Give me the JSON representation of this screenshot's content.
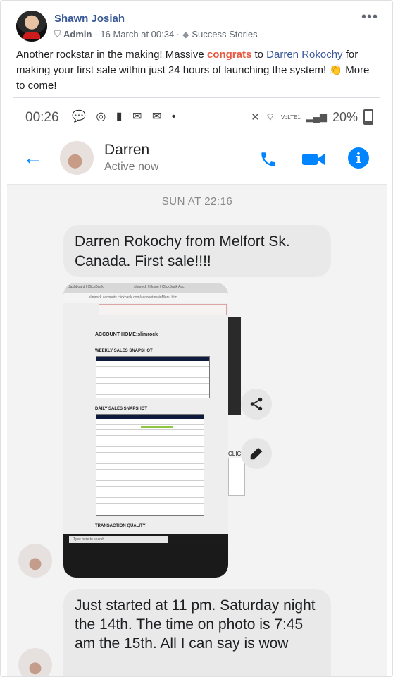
{
  "post": {
    "author": "Shawn Josiah",
    "role": "Admin",
    "date": "· 16 March at 00:34 ·",
    "topic": "Success Stories",
    "more_icon": "more-dots-icon",
    "text_pre": "Another rockstar in the making! Massive ",
    "text_highlight": "congrats",
    "text_mid": " to ",
    "text_link": "Darren Rokochy",
    "text_post": " for making your first sale within just 24 hours of launching the system! 👏 More to come!"
  },
  "phone": {
    "status_time": "00:26",
    "status_icons_left": "💬 ◎ ▮ ✉ ✉ •",
    "signal_text": "VoLTE1",
    "battery_percent": "20%",
    "chat": {
      "name": "Darren",
      "status": "Active now",
      "timestamp": "SUN AT 22:16",
      "message1": "Darren Rokochy from Melfort Sk. Canada. First sale!!!!",
      "message2": "Just started at 11 pm. Saturday night the 14th. The time on photo is 7:45 am the 15th. All I can say is wow"
    },
    "photo": {
      "tab1": "Dashboard | ClickBank",
      "tab2": "slimrock | Home | ClickBank Acc",
      "url": "slimrock.accounts.clickbank.com/account/mainMenu.htm",
      "account_home": "ACCOUNT HOME:slimrock",
      "weekly": "WEEKLY SALES SNAPSHOT",
      "daily": "DAILY SALES SNAPSHOT",
      "transaction": "TRANSACTION QUALITY",
      "taskbar_search": "Type here to search",
      "side_label": "CLICK"
    }
  },
  "colors": {
    "accent": "#0084ff",
    "author_blue": "#385898",
    "highlight": "#e9573f"
  }
}
